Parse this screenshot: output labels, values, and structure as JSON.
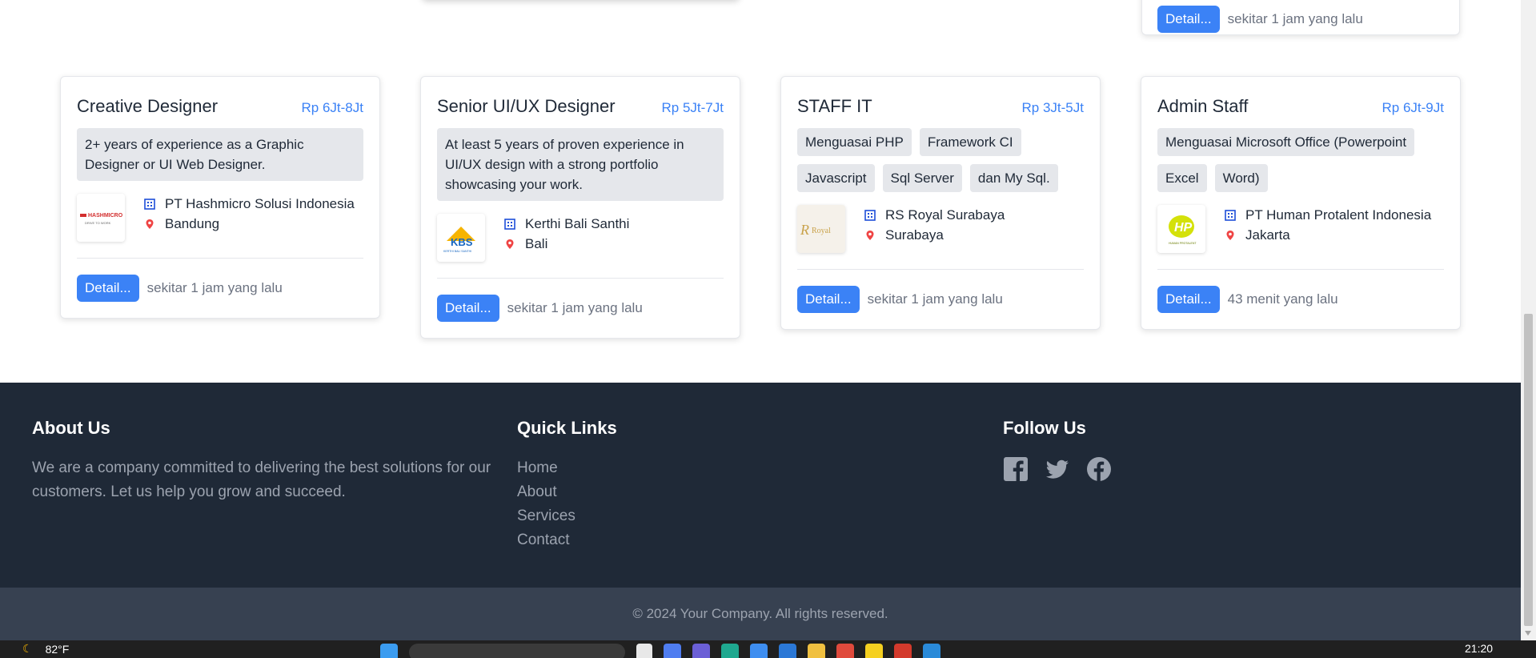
{
  "top_partial": {
    "detail_label": "Detail...",
    "time_ago": "sekitar 1 jam yang lalu"
  },
  "jobs": [
    {
      "title": "Creative Designer",
      "salary": "Rp 6Jt-8Jt",
      "description": "2+ years of experience as a Graphic Designer or UI Web Designer.",
      "company": "PT Hashmicro Solusi Indonesia",
      "location": "Bandung",
      "logo_text": "HASHMICRO",
      "detail_label": "Detail...",
      "time_ago": "sekitar 1 jam yang lalu"
    },
    {
      "title": "Senior UI/UX Designer",
      "salary": "Rp 5Jt-7Jt",
      "description": "At least 5 years of proven experience in UI/UX design with a strong portfolio showcasing your work.",
      "company": "Kerthi Bali Santhi",
      "location": "Bali",
      "logo_text": "KBS",
      "detail_label": "Detail...",
      "time_ago": "sekitar 1 jam yang lalu"
    },
    {
      "title": "STAFF IT",
      "salary": "Rp 3Jt-5Jt",
      "tags": [
        "Menguasai PHP",
        "Framework CI",
        "Javascript",
        "Sql Server",
        "dan My Sql."
      ],
      "company": "RS Royal Surabaya",
      "location": "Surabaya",
      "logo_text": "Royal",
      "detail_label": "Detail...",
      "time_ago": "sekitar 1 jam yang lalu"
    },
    {
      "title": "Admin Staff",
      "salary": "Rp 6Jt-9Jt",
      "tags": [
        "Menguasai Microsoft Office (Powerpoint",
        "Excel",
        "Word)"
      ],
      "company": "PT Human Protalent Indonesia",
      "location": "Jakarta",
      "logo_text": "HP",
      "detail_label": "Detail...",
      "time_ago": "43 menit yang lalu"
    }
  ],
  "footer": {
    "about_title": "About Us",
    "about_text": "We are a company committed to delivering the best solutions for our customers. Let us help you grow and succeed.",
    "links_title": "Quick Links",
    "links": [
      "Home",
      "About",
      "Services",
      "Contact"
    ],
    "follow_title": "Follow Us",
    "social_icons": [
      "facebook-square-icon",
      "twitter-icon",
      "facebook-circle-icon"
    ],
    "copyright": "© 2024 Your Company. All rights reserved."
  },
  "taskbar": {
    "temperature": "82°F",
    "time": "21:20"
  },
  "colors": {
    "accent": "#3b82f6",
    "footer_bg": "#1f2937",
    "copyright_bg": "#374151"
  }
}
